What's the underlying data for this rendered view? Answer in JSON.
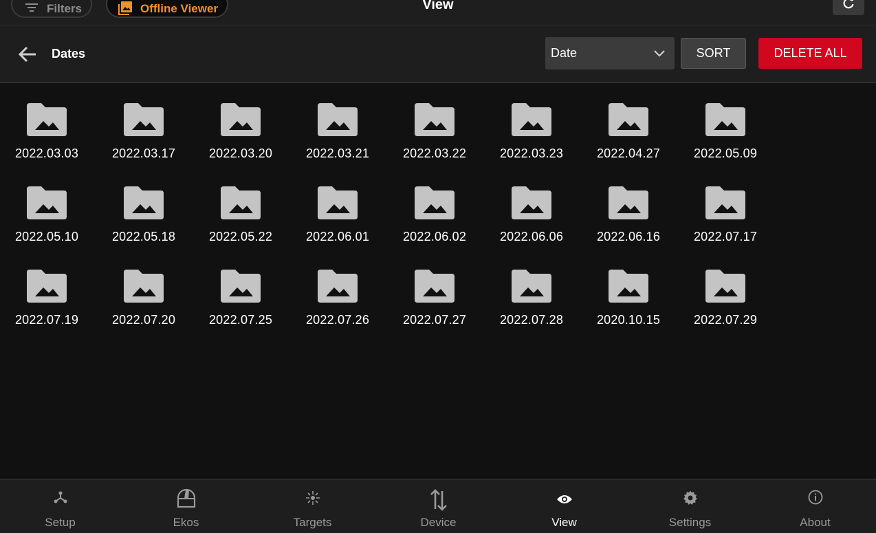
{
  "topbar": {
    "filters_label": "Filters",
    "offline_label": "Offline Viewer",
    "title": "View",
    "accent_color": "#f0922b"
  },
  "header": {
    "title": "Dates",
    "sort_select_value": "Date",
    "sort_label": "SORT",
    "delete_all_label": "DELETE ALL",
    "delete_color": "#d1061f"
  },
  "folders": [
    "2022.03.03",
    "2022.03.17",
    "2022.03.20",
    "2022.03.21",
    "2022.03.22",
    "2022.03.23",
    "2022.04.27",
    "2022.05.09",
    "2022.05.10",
    "2022.05.18",
    "2022.05.22",
    "2022.06.01",
    "2022.06.02",
    "2022.06.06",
    "2022.06.16",
    "2022.07.17",
    "2022.07.19",
    "2022.07.20",
    "2022.07.25",
    "2022.07.26",
    "2022.07.27",
    "2022.07.28",
    "2020.10.15",
    "2022.07.29"
  ],
  "folder_icon": "folder-image-icon",
  "nav": [
    {
      "label": "Setup",
      "icon": "setup-icon",
      "active": false
    },
    {
      "label": "Ekos",
      "icon": "ekos-icon",
      "active": false
    },
    {
      "label": "Targets",
      "icon": "targets-icon",
      "active": false
    },
    {
      "label": "Device",
      "icon": "device-icon",
      "active": false
    },
    {
      "label": "View",
      "icon": "eye-icon",
      "active": true
    },
    {
      "label": "Settings",
      "icon": "gear-icon",
      "active": false
    },
    {
      "label": "About",
      "icon": "info-icon",
      "active": false
    }
  ]
}
